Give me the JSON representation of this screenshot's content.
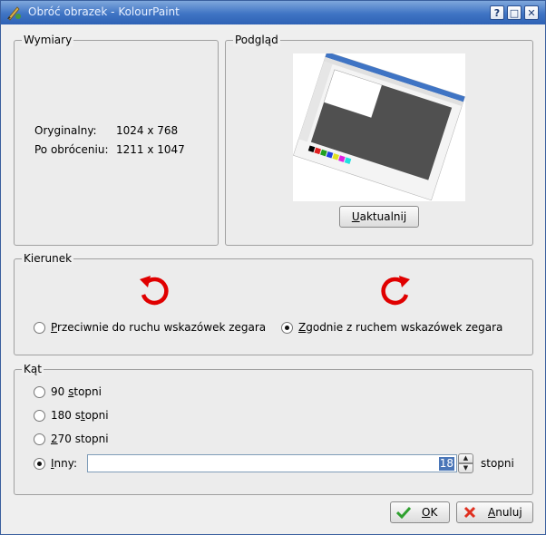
{
  "window": {
    "title": "Obróć obrazek - KolourPaint",
    "help_label": "?",
    "maximize_label": "□",
    "close_label": "✕"
  },
  "dimensions": {
    "legend": "Wymiary",
    "original_label": "Oryginalny:",
    "original_value": "1024 x 768",
    "rotated_label": "Po obróceniu:",
    "rotated_value": "1211 x 1047"
  },
  "preview": {
    "legend": "Podgląd",
    "update_button_u": "U",
    "update_button_rest": "aktualnij"
  },
  "direction": {
    "legend": "Kierunek",
    "ccw": {
      "u": "P",
      "rest": "rzeciwnie do ruchu wskazówek zegara",
      "selected": false
    },
    "cw": {
      "u": "Z",
      "rest": "godnie z ruchem wskazówek zegara",
      "selected": true
    },
    "ccw_icon": "rotate-counterclockwise-icon",
    "cw_icon": "rotate-clockwise-icon",
    "icon_color": "#e00000"
  },
  "angle": {
    "legend": "Kąt",
    "opt90_pre": "90 ",
    "opt90_u": "s",
    "opt90_post": "topni",
    "opt180_pre": "180 s",
    "opt180_u": "t",
    "opt180_post": "opni",
    "opt270_u": "2",
    "opt270_post": "70 stopni",
    "other_u": "I",
    "other_post": "nny:",
    "other_value": "18",
    "unit": "stopni",
    "selected": "other"
  },
  "footer": {
    "ok_u": "O",
    "ok_rest": "K",
    "cancel_u": "A",
    "cancel_rest": "nuluj"
  }
}
